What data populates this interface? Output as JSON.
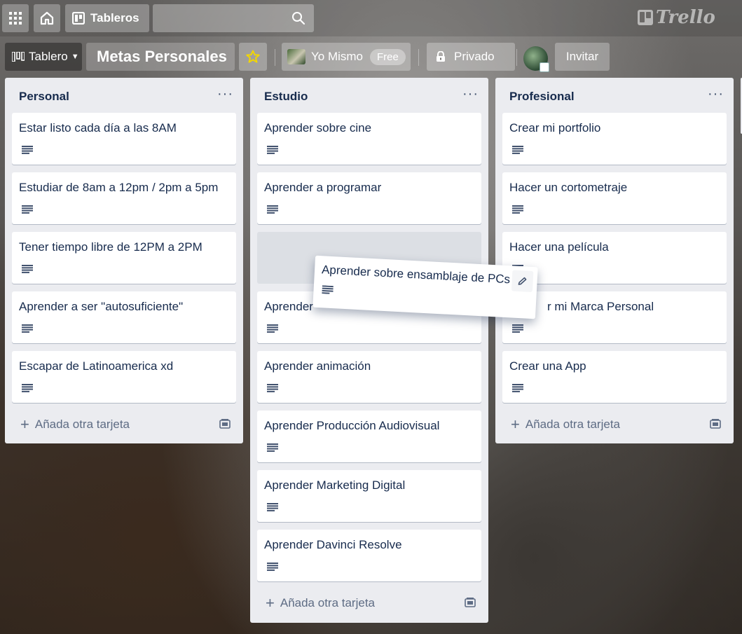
{
  "topbar": {
    "boards_label": "Tableros",
    "search_value": "",
    "logo_text": "Trello"
  },
  "boardbar": {
    "view_label": "Tablero",
    "board_title": "Metas Personales",
    "team_label": "Yo Mismo",
    "team_badge": "Free",
    "privacy_label": "Privado",
    "invite_label": "Invitar"
  },
  "colors": {
    "list_bg": "#ebecf0",
    "card_bg": "#ffffff",
    "text": "#172b4d",
    "muted": "#5e6c84",
    "star": "#f2d600"
  },
  "lists": [
    {
      "title": "Personal",
      "cards": [
        "Estar listo cada día a las 8AM",
        "Estudiar de 8am a 12pm / 2pm a 5pm",
        "Tener tiempo libre de 12PM a 2PM",
        "Aprender a ser \"autosuficiente\"",
        "Escapar de Latinoamerica xd"
      ],
      "add_label": "Añada otra tarjeta"
    },
    {
      "title": "Estudio",
      "cards": [
        "Aprender sobre cine",
        "Aprender a programar",
        "",
        "Aprender",
        "Aprender animación",
        "Aprender Producción Audiovisual",
        "Aprender Marketing Digital",
        "Aprender Davinci Resolve"
      ],
      "add_label": "Añada otra tarjeta"
    },
    {
      "title": "Profesional",
      "cards": [
        "Crear mi portfolio",
        "Hacer un cortometraje",
        "Hacer una película",
        "r mi Marca Personal",
        "Crear una App"
      ],
      "add_label": "Añada otra tarjeta"
    }
  ],
  "dragging_card": {
    "title": "Aprender sobre ensamblaje de PCs"
  }
}
